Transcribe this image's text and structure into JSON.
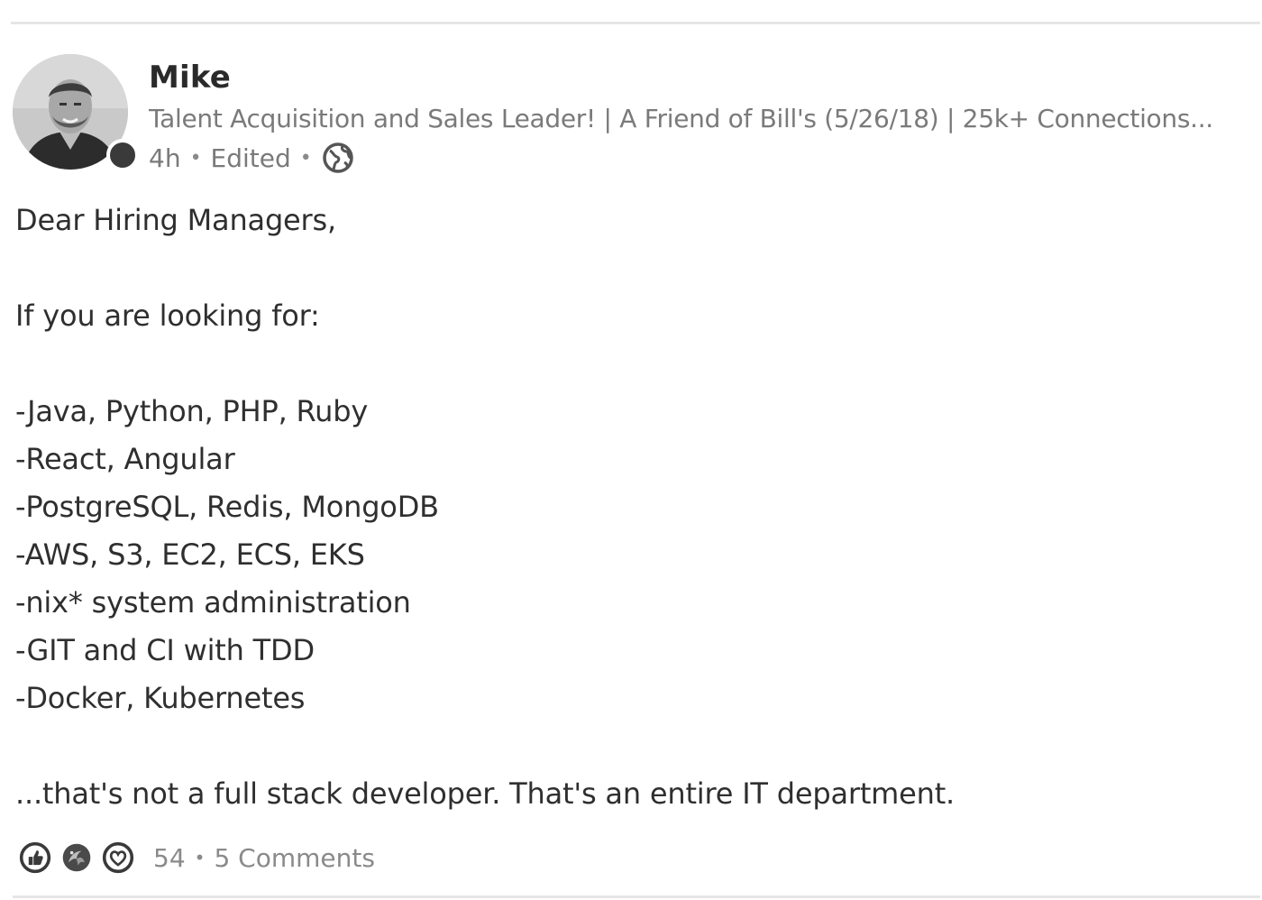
{
  "post": {
    "author": {
      "name": "Mike",
      "headline": "Talent Acquisition and Sales Leader! | A Friend of Bill's (5/26/18) | 25k+ Connections...",
      "avatar_icon": "profile-photo"
    },
    "meta": {
      "time": "4h",
      "separator": "•",
      "edited": "Edited",
      "visibility_icon": "globe-icon"
    },
    "body": {
      "greeting": "Dear Hiring Managers,",
      "intro": "If you are looking for:",
      "items": [
        "-Java, Python, PHP, Ruby",
        "-React, Angular",
        "-PostgreSQL, Redis, MongoDB",
        "-AWS, S3, EC2, ECS, EKS",
        "-nix* system administration",
        "-GIT and CI with TDD",
        "-Docker, Kubernetes"
      ],
      "closing": "...that's not a full stack developer. That's an entire IT department."
    },
    "social": {
      "reaction_icons": [
        "like-icon",
        "celebrate-icon",
        "love-icon"
      ],
      "reaction_count": "54",
      "separator": "•",
      "comments": "5 Comments"
    }
  },
  "colors": {
    "text_primary": "#2f2f2f",
    "text_secondary": "#7a7a7a",
    "presence_dot": "#3a3a3a",
    "divider": "#e6e6e6"
  }
}
